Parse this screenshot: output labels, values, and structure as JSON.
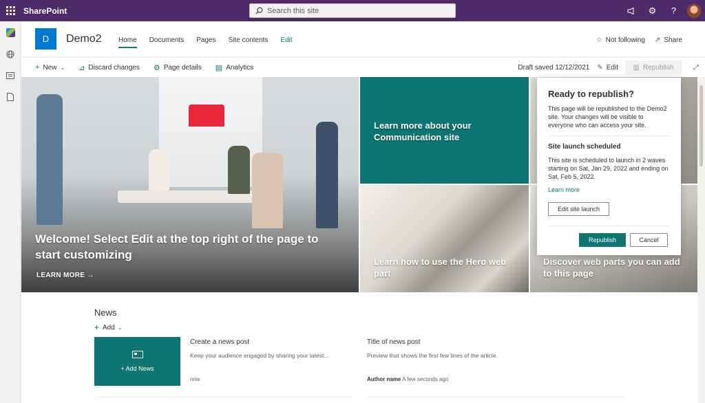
{
  "suite": {
    "app_name": "SharePoint",
    "search_placeholder": "Search this site"
  },
  "site": {
    "logo_letter": "D",
    "title": "Demo2",
    "nav": [
      "Home",
      "Documents",
      "Pages",
      "Site contents",
      "Edit"
    ],
    "follow_label": "Not following",
    "share_label": "Share"
  },
  "commandbar": {
    "new_label": "New",
    "discard_label": "Discard changes",
    "page_details_label": "Page details",
    "analytics_label": "Analytics",
    "draft_status": "Draft saved 12/12/2021",
    "edit_label": "Edit",
    "republish_label": "Republish"
  },
  "hero": {
    "main_title": "Welcome! Select Edit at the top right of the page to start customizing",
    "main_link": "LEARN MORE",
    "tile1": "Learn more about your Communication site",
    "tile2": "Learn how to use the Hero web part",
    "tile3": "Discover web parts you can add to this page"
  },
  "panel": {
    "title": "Ready to republish?",
    "intro": "This page will be republished to the Demo2 site. Your changes will be visible to everyone who can access your site.",
    "section_title": "Site launch scheduled",
    "section_text": "This site is scheduled to launch in 2 waves starting on Sat, Jan 29, 2022 and ending on Sat, Feb 5, 2022.",
    "learn_more": "Learn more",
    "edit_launch": "Edit site launch",
    "republish": "Republish",
    "cancel": "Cancel"
  },
  "news": {
    "title": "News",
    "add_label": "Add",
    "add_news_label": "Add News",
    "posts": [
      {
        "title": "Create a news post",
        "desc": "Keep your audience engaged by sharing your latest...",
        "author": "",
        "time": "now"
      },
      {
        "title": "Title of news post",
        "desc": "Preview that shows the first few lines of the article.",
        "author": "Author name",
        "time": "A few seconds ago"
      }
    ]
  }
}
